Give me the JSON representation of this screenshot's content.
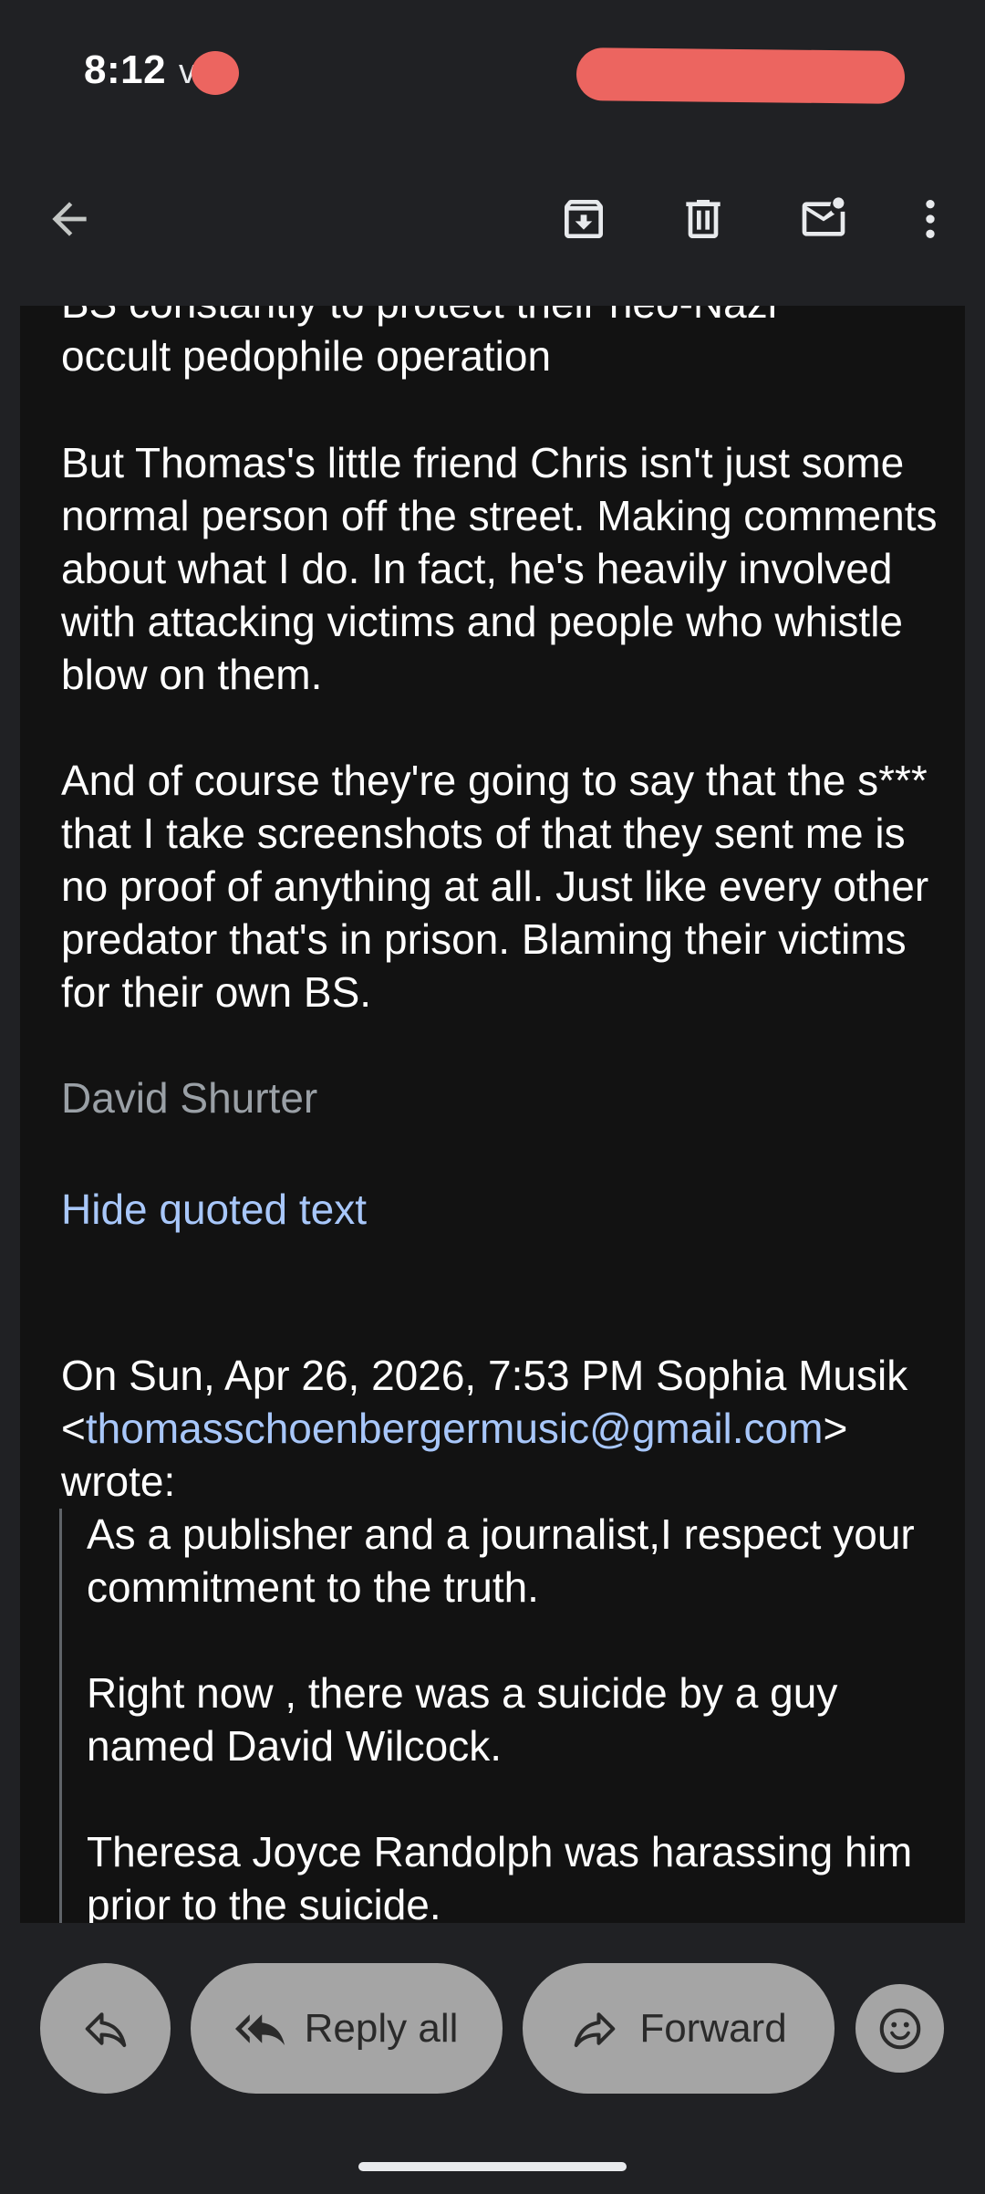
{
  "status_bar": {
    "time": "8:12",
    "glyph": "v"
  },
  "toolbar": {
    "back_icon": "arrow-back-icon",
    "archive_icon": "archive-icon",
    "delete_icon": "trash-icon",
    "mark_unread_icon": "mark-unread-icon",
    "more_icon": "more-vert-icon"
  },
  "message": {
    "cut_line": "BS constantly to protect their neo-Nazi",
    "para1_tail": "occult pedophile operation",
    "para2": "But Thomas's little friend Chris isn't just some normal person off the street. Making comments about what I do. In fact, he's heavily involved with attacking victims and people who whistle blow on them.",
    "para3": "And of course they're going to say that the s*** that I take screenshots of that they sent me is no proof of anything at all. Just like every other predator that's in prison. Blaming their victims for their own BS.",
    "signature": "David Shurter",
    "hide_quoted": "Hide quoted text"
  },
  "quoted": {
    "header_prefix": "On Sun, Apr 26, 2026, 7:53 PM Sophia Musik <",
    "email": "thomasschoenbergermusic@gmail.com",
    "header_suffix": "> wrote:",
    "q1": "As a publisher and a journalist,I respect your commitment to the truth.",
    "q2": "Right now , there was a suicide by a guy named David Wilcock.",
    "q3": "Theresa Joyce Randolph was harassing him prior to the suicide."
  },
  "actions": {
    "reply_icon": "reply-icon",
    "reply_all_label": "Reply all",
    "forward_label": "Forward",
    "emoji_icon": "emoji-icon"
  }
}
